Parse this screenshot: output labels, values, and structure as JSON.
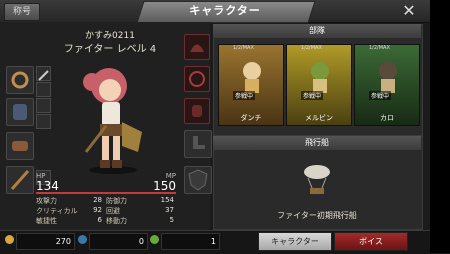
{
  "header": {
    "rank_button": "称号",
    "title": "キャラクター",
    "close": "✕"
  },
  "character": {
    "name": "かすみ0211",
    "class_level": "ファイター レベル 4",
    "hp_label": "HP",
    "hp": "134",
    "mp_label": "MP",
    "mp": "150"
  },
  "stats": [
    {
      "label": "攻撃力",
      "value": "28",
      "label2": "防御力",
      "value2": "154"
    },
    {
      "label": "クリティカル",
      "value": "92",
      "label2": "回避",
      "value2": "37"
    },
    {
      "label": "敏捷性",
      "value": "6",
      "label2": "移動力",
      "value2": "5"
    }
  ],
  "party": {
    "title": "部隊",
    "members": [
      {
        "name": "ダンチ",
        "status": "参戦中",
        "level_tag": "1/2/MAX",
        "color": "#7a5a1e"
      },
      {
        "name": "メルビン",
        "status": "参戦中",
        "level_tag": "1/2/MAX",
        "color": "#8a7a1c"
      },
      {
        "name": "カロ",
        "status": "参戦中",
        "level_tag": "1/2/MAX",
        "color": "#2e5a2c"
      }
    ]
  },
  "airship": {
    "title": "飛行船",
    "name": "ファイター初期飛行船"
  },
  "currency": {
    "gold": "270",
    "gem": "0",
    "point": "1"
  },
  "tabs": {
    "character": "キャラクター",
    "voice": "ボイス"
  },
  "colors": {
    "accent_red": "#c33a3a",
    "active_tab": "#c9c9c9",
    "voice_tab": "#8a1d1d"
  }
}
